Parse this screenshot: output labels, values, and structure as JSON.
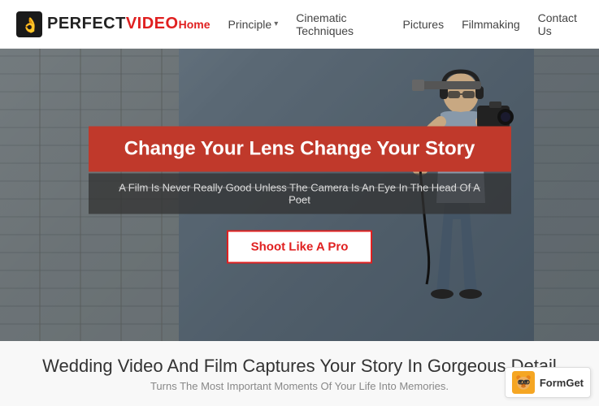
{
  "header": {
    "logo_perfect": "PERFECT",
    "logo_video": "VIDEO",
    "nav": {
      "items": [
        {
          "label": "Home",
          "active": true,
          "has_dropdown": false
        },
        {
          "label": "Principle",
          "active": false,
          "has_dropdown": true
        },
        {
          "label": "Cinematic Techniques",
          "active": false,
          "has_dropdown": false
        },
        {
          "label": "Pictures",
          "active": false,
          "has_dropdown": false
        },
        {
          "label": "Filmmaking",
          "active": false,
          "has_dropdown": false
        },
        {
          "label": "Contact Us",
          "active": false,
          "has_dropdown": false
        }
      ]
    }
  },
  "hero": {
    "title": "Change Your Lens Change Your Story",
    "subtitle": "A Film Is Never Really Good Unless The Camera Is An Eye In The Head Of A Poet",
    "cta_label": "Shoot Like A Pro"
  },
  "bottom": {
    "title": "Wedding Video And Film Captures Your Story In Gorgeous Detail",
    "subtitle": "Turns The Most Important Moments Of Your Life Into Memories.",
    "formget_label": "FormGet"
  }
}
